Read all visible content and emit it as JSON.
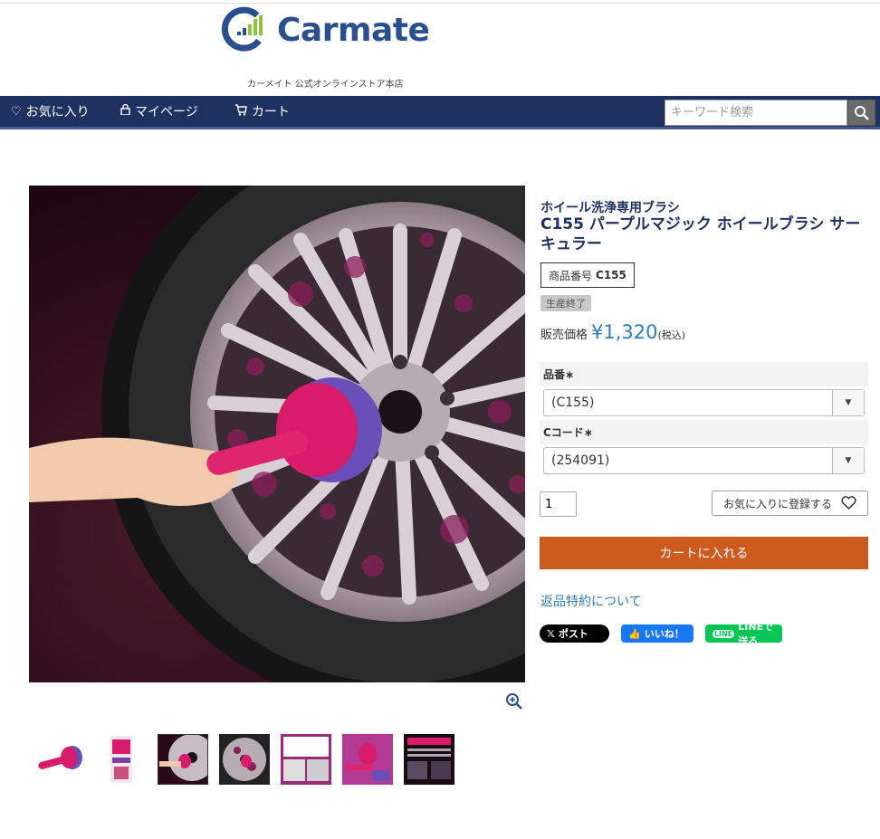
{
  "header": {
    "brand": "Carmate",
    "tagline": "カーメイト 公式オンラインストア本店",
    "colors": {
      "brand": "#2a4f8f",
      "accent_green": "#8bc53f"
    }
  },
  "nav": {
    "favorites": "お気に入り",
    "mypage": "マイページ",
    "cart": "カート",
    "search_placeholder": "キーワード検索",
    "background": "#1e3160"
  },
  "product": {
    "category": "ホイール洗浄専用ブラシ",
    "title": "C155 パープルマジック ホイールブラシ サーキュラー",
    "sku_label": "商品番号",
    "sku": "C155",
    "status_badge": "生産終了",
    "price_label": "販売価格",
    "price": "¥1,320",
    "tax_note": "(税込)",
    "options": [
      {
        "label": "品番∗",
        "selected": "(C155)"
      },
      {
        "label": "Cコード∗",
        "selected": "(254091)"
      }
    ],
    "quantity": "1",
    "favorite_button": "お気に入りに登録する",
    "cart_button": "カートに入れる",
    "returns_link": "返品特約について"
  },
  "social": {
    "x": "ポスト",
    "facebook": "いいね！",
    "line": "LINEで送る"
  },
  "gallery": {
    "thumbnails": [
      "brush-product",
      "package",
      "wheel-action-1",
      "wheel-action-2",
      "info-card-1",
      "info-card-2",
      "info-card-3"
    ]
  },
  "colors": {
    "price": "#2e7bbf",
    "cart_button": "#cd5a1e",
    "brush_pink": "#d81b6a"
  }
}
